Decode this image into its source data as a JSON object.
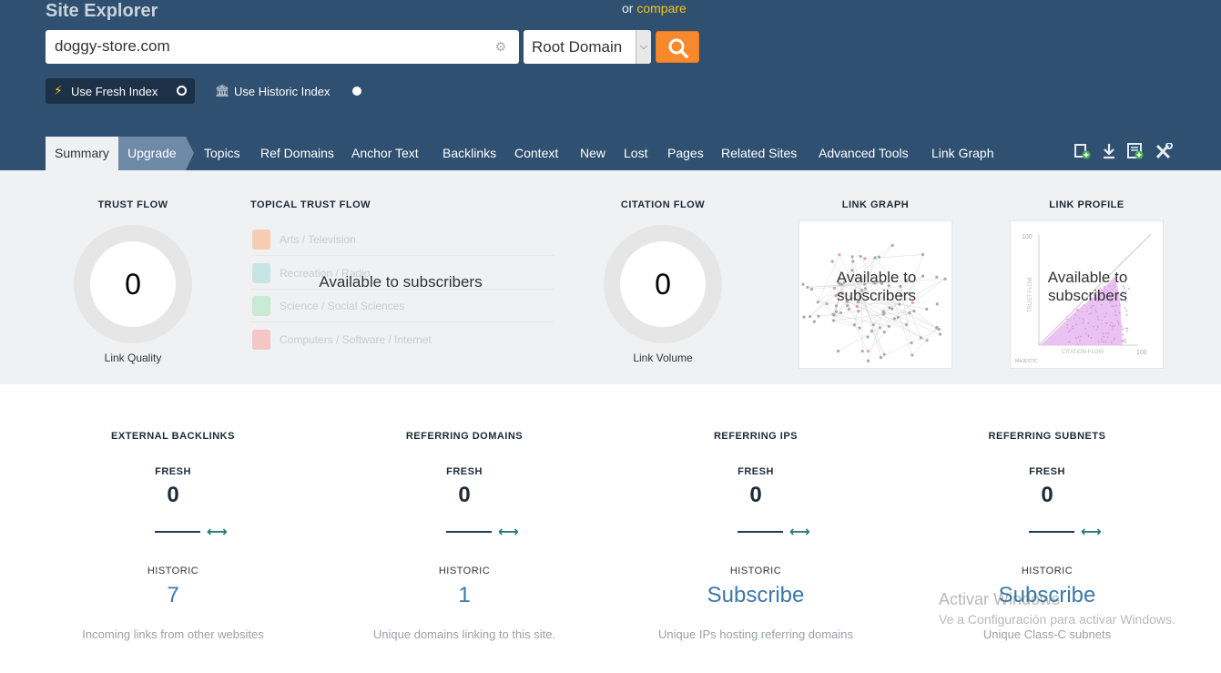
{
  "header": {
    "title": "Site Explorer",
    "compare_prefix": "or",
    "compare_link": "compare",
    "search_value": "doggy-store.com",
    "scope_select": "Root Domain",
    "fresh_index_label": "Use Fresh Index",
    "historic_index_label": "Use Historic Index"
  },
  "tabs": [
    {
      "label": "Summary"
    },
    {
      "label": "Upgrade"
    },
    {
      "label": "Topics"
    },
    {
      "label": "Ref Domains"
    },
    {
      "label": "Anchor Text"
    },
    {
      "label": "Backlinks"
    },
    {
      "label": "Context"
    },
    {
      "label": "New"
    },
    {
      "label": "Lost"
    },
    {
      "label": "Pages"
    },
    {
      "label": "Related Sites"
    },
    {
      "label": "Advanced Tools"
    },
    {
      "label": "Link Graph"
    }
  ],
  "icons": [
    "add-bookmark-icon",
    "download-icon",
    "report-icon",
    "tools-icon"
  ],
  "metrics": {
    "trust_flow": {
      "title": "TRUST FLOW",
      "value": "0",
      "caption": "Link Quality"
    },
    "topical_trust_flow": {
      "title": "TOPICAL TRUST FLOW",
      "overlay": "Available to subscribers",
      "topics": [
        {
          "label": "Arts / Television",
          "color": "#f6cdb3"
        },
        {
          "label": "Recreation / Radio",
          "color": "#c7e6e3"
        },
        {
          "label": "Science / Social Sciences",
          "color": "#c9ebd3"
        },
        {
          "label": "Computers / Software / Internet",
          "color": "#f4c6c6"
        }
      ]
    },
    "citation_flow": {
      "title": "CITATION FLOW",
      "value": "0",
      "caption": "Link Volume"
    },
    "link_graph": {
      "title": "LINK GRAPH",
      "overlay_line1": "Available to",
      "overlay_line2": "subscribers"
    },
    "link_profile": {
      "title": "LINK PROFILE",
      "overlay_line1": "Available to",
      "overlay_line2": "subscribers",
      "y_tick": "100",
      "x_tick": "100",
      "y_label": "TRUST FLOW",
      "x_label": "CITATION FLOW",
      "logo_text": "MAJESTIC"
    }
  },
  "stats": [
    {
      "title": "EXTERNAL BACKLINKS",
      "fresh_label": "FRESH",
      "fresh_value": "0",
      "historic_label": "HISTORIC",
      "historic_value": "7",
      "description": "Incoming links from other websites"
    },
    {
      "title": "REFERRING DOMAINS",
      "fresh_label": "FRESH",
      "fresh_value": "0",
      "historic_label": "HISTORIC",
      "historic_value": "1",
      "description": "Unique domains linking to this site."
    },
    {
      "title": "REFERRING IPS",
      "fresh_label": "FRESH",
      "fresh_value": "0",
      "historic_label": "HISTORIC",
      "historic_value": "Subscribe",
      "description": "Unique IPs hosting referring domains"
    },
    {
      "title": "REFERRING SUBNETS",
      "fresh_label": "FRESH",
      "fresh_value": "0",
      "historic_label": "HISTORIC",
      "historic_value": "Subscribe",
      "description": "Unique Class-C subnets"
    }
  ],
  "watermark": {
    "line1": "Activar Windows",
    "line2": "Ve a Configuración para activar Windows."
  },
  "colors": {
    "header_bg": "#2f5070",
    "accent_orange": "#f7892c",
    "compare_link": "#f5c518",
    "link_blue": "#3b78a8"
  }
}
